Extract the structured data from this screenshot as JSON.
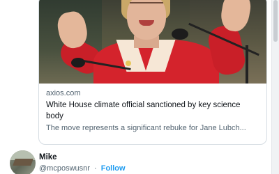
{
  "card": {
    "domain": "axios.com",
    "title": "White House climate official sanctioned by key science body",
    "description": "The move represents a significant rebuke for Jane Lubch..."
  },
  "author": {
    "name": "Mike",
    "handle": "@mcposwusnr",
    "separator": "·",
    "follow_label": "Follow"
  },
  "colors": {
    "link_blue": "#1d9bf0",
    "muted_text": "#536471",
    "primary_text": "#0f1419",
    "card_border": "#d6dde3"
  }
}
